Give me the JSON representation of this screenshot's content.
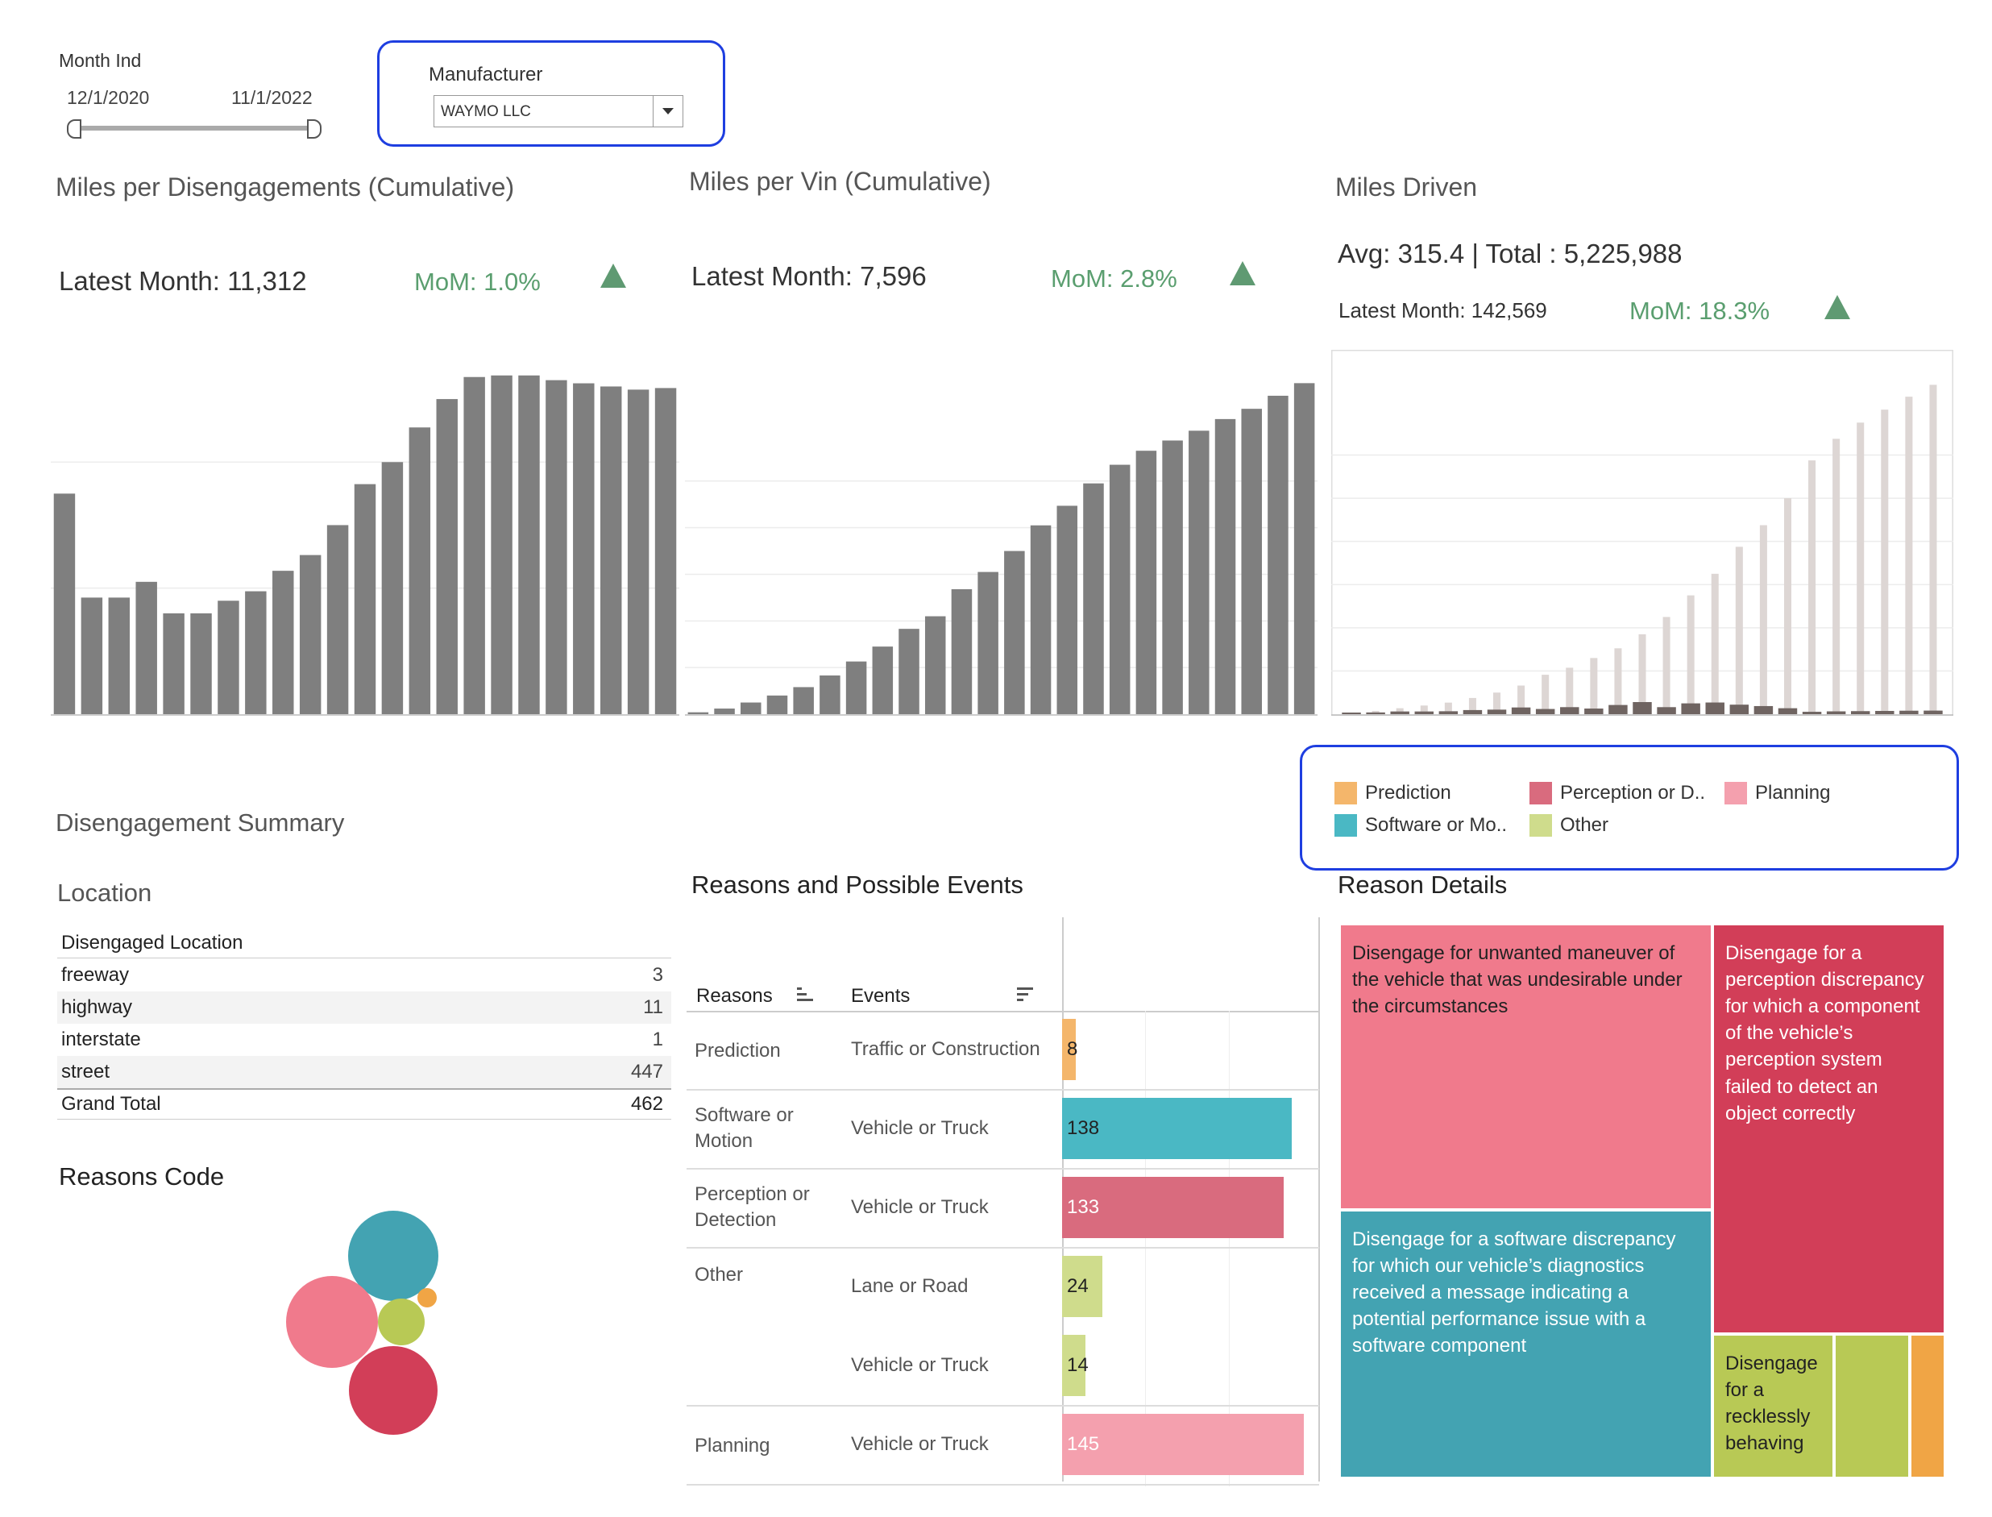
{
  "filters": {
    "month_label": "Month Ind",
    "month_start": "12/1/2020",
    "month_end": "11/1/2022",
    "manufacturer_label": "Manufacturer",
    "manufacturer_value": "WAYMO LLC"
  },
  "kpis": {
    "mpd": {
      "title": "Miles per Disengagements (Cumulative)",
      "latest": "Latest Month:  11,312",
      "mom": "MoM: 1.0%"
    },
    "mpv": {
      "title": "Miles per Vin (Cumulative)",
      "latest": "Latest Month:  7,596",
      "mom": "MoM: 2.8%"
    },
    "miles": {
      "title": "Miles Driven",
      "avg_total": "Avg: 315.4  | Total : 5,225,988",
      "latest": "Latest Month:  142,569",
      "mom": "MoM: 18.3%"
    }
  },
  "legend": [
    {
      "label": "Prediction",
      "color": "#f4b66b"
    },
    {
      "label": "Perception or D..",
      "color": "#d96b7e"
    },
    {
      "label": "Planning",
      "color": "#f4a0ae"
    },
    {
      "label": "Software or Mo..",
      "color": "#4ab8c4"
    },
    {
      "label": "Other",
      "color": "#cfdc8c"
    }
  ],
  "summary": {
    "title": "Disengagement Summary",
    "location_title": "Location",
    "location_header": "Disengaged Location",
    "rows": [
      {
        "name": "freeway",
        "value": "3"
      },
      {
        "name": "highway",
        "value": "11"
      },
      {
        "name": "interstate",
        "value": "1"
      },
      {
        "name": "street",
        "value": "447"
      }
    ],
    "grand_total_label": "Grand Total",
    "grand_total_value": "462",
    "reasons_code_title": "Reasons Code"
  },
  "reasons": {
    "title": "Reasons and Possible Events",
    "col_reasons": "Reasons",
    "col_events": "Events",
    "rows": [
      {
        "reason": "Prediction",
        "event": "Traffic or Construction",
        "value": 8,
        "label": "8",
        "color": "#f4b66b"
      },
      {
        "reason": "Software or Motion",
        "event": "Vehicle or Truck",
        "value": 138,
        "label": "138",
        "color": "#4ab8c4"
      },
      {
        "reason": "Perception or Detection",
        "event": "Vehicle or Truck",
        "value": 133,
        "label": "133",
        "color": "#d96b7e"
      },
      {
        "reason": "Other",
        "event": "Lane or Road",
        "value": 24,
        "label": "24",
        "color": "#cfdc8c"
      },
      {
        "reason": "",
        "event": "Vehicle or Truck",
        "value": 14,
        "label": "14",
        "color": "#cfdc8c"
      },
      {
        "reason": "Planning",
        "event": "Vehicle or Truck",
        "value": 145,
        "label": "145",
        "color": "#f4a0ae"
      }
    ]
  },
  "treemap": {
    "title": "Reason Details",
    "cells": [
      {
        "text": "Disengage for unwanted maneuver of the vehicle that was undesirable under the circumstances",
        "color": "#f07a8c"
      },
      {
        "text": "Disengage for a perception discrepancy for which a component of the vehicle’s perception system failed to detect an object correctly",
        "color": "#d23e58"
      },
      {
        "text": "Disengage for a software discrepancy for which our vehicle’s diagnostics received a message indicating a potential performance issue with a software component",
        "color": "#43a3b2"
      },
      {
        "text": "Disengage for a recklessly behaving",
        "color": "#b8c955"
      },
      {
        "text": "",
        "color": "#b8c955"
      },
      {
        "text": "",
        "color": "#f0a545"
      }
    ]
  },
  "chart_data": [
    {
      "type": "bar",
      "title": "Miles per Disengagements (Cumulative)",
      "values": [
        7000,
        3700,
        3700,
        4200,
        3200,
        3200,
        3600,
        3900,
        4550,
        5050,
        6000,
        7300,
        8000,
        9100,
        10000,
        10700,
        10750,
        10750,
        10600,
        10500,
        10400,
        10300,
        10350
      ],
      "ylim": [
        0,
        11000
      ]
    },
    {
      "type": "bar",
      "title": "Miles per Vin (Cumulative)",
      "values": [
        40,
        120,
        250,
        400,
        580,
        830,
        1130,
        1450,
        1830,
        2100,
        2680,
        3050,
        3500,
        4050,
        4470,
        4950,
        5350,
        5650,
        5870,
        6080,
        6330,
        6550,
        6830,
        7100
      ],
      "ylim": [
        0,
        7400
      ]
    },
    {
      "type": "bar",
      "title": "Miles Driven",
      "series": [
        {
          "name": "Monthly",
          "values": [
            15000,
            16000,
            25000,
            25000,
            27000,
            38000,
            42000,
            62000,
            48000,
            65000,
            52000,
            85000,
            112000,
            65000,
            100000,
            108000,
            88000,
            75000,
            55000,
            22000,
            26000,
            28000,
            30000,
            32000,
            33000
          ]
        },
        {
          "name": "Cumulative",
          "values": [
            15000,
            30000,
            55000,
            80000,
            107000,
            150000,
            200000,
            265000,
            365000,
            430000,
            520000,
            610000,
            740000,
            900000,
            1100000,
            1300000,
            1550000,
            1750000,
            2000000,
            2350000,
            2550000,
            2700000,
            2820000,
            2940000,
            3050000
          ]
        }
      ],
      "ylim": [
        0,
        3150000
      ]
    },
    {
      "type": "bar",
      "title": "Reasons and Possible Events",
      "categories": [
        "Prediction | Traffic or Construction",
        "Software or Motion | Vehicle or Truck",
        "Perception or Detection | Vehicle or Truck",
        "Other | Lane or Road",
        "Other | Vehicle or Truck",
        "Planning | Vehicle or Truck"
      ],
      "values": [
        8,
        138,
        133,
        24,
        14,
        145
      ],
      "xlim": [
        0,
        150
      ]
    }
  ]
}
